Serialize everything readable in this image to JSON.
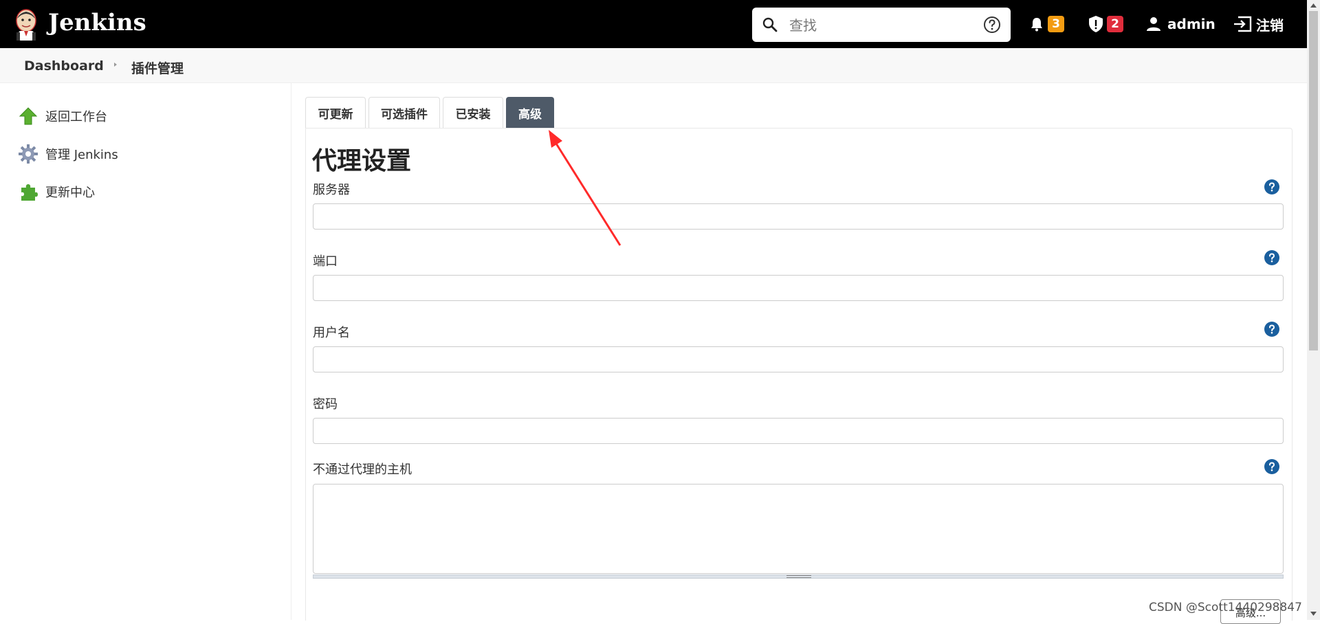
{
  "header": {
    "brand": "Jenkins",
    "search": {
      "placeholder": "查找"
    },
    "notifications": {
      "count": "3",
      "color": "#f39c12"
    },
    "security": {
      "count": "2",
      "color": "#e02d3c"
    },
    "user": "admin",
    "logout": "注销"
  },
  "breadcrumb": {
    "items": [
      "Dashboard",
      "插件管理"
    ]
  },
  "sidebar": {
    "items": [
      {
        "label": "返回工作台",
        "icon": "arrow-up-icon"
      },
      {
        "label": "管理 Jenkins",
        "icon": "gear-icon"
      },
      {
        "label": "更新中心",
        "icon": "puzzle-icon"
      }
    ]
  },
  "tabs": [
    {
      "label": "可更新",
      "active": false
    },
    {
      "label": "可选插件",
      "active": false
    },
    {
      "label": "已安装",
      "active": false
    },
    {
      "label": "高级",
      "active": true
    }
  ],
  "proxy": {
    "title": "代理设置",
    "fields": [
      {
        "label": "服务器",
        "value": ""
      },
      {
        "label": "端口",
        "value": ""
      },
      {
        "label": "用户名",
        "value": ""
      },
      {
        "label": "密码",
        "value": ""
      }
    ],
    "no_proxy_hosts": {
      "label": "不通过代理的主机",
      "value": ""
    },
    "advanced_button": "高级..."
  },
  "watermark": "CSDN @Scott1440298847",
  "colors": {
    "header_bg": "#000000",
    "active_tab": "#4e5a68",
    "help_icon": "#1a5f9e",
    "annotation_arrow": "#ff2a2a"
  }
}
